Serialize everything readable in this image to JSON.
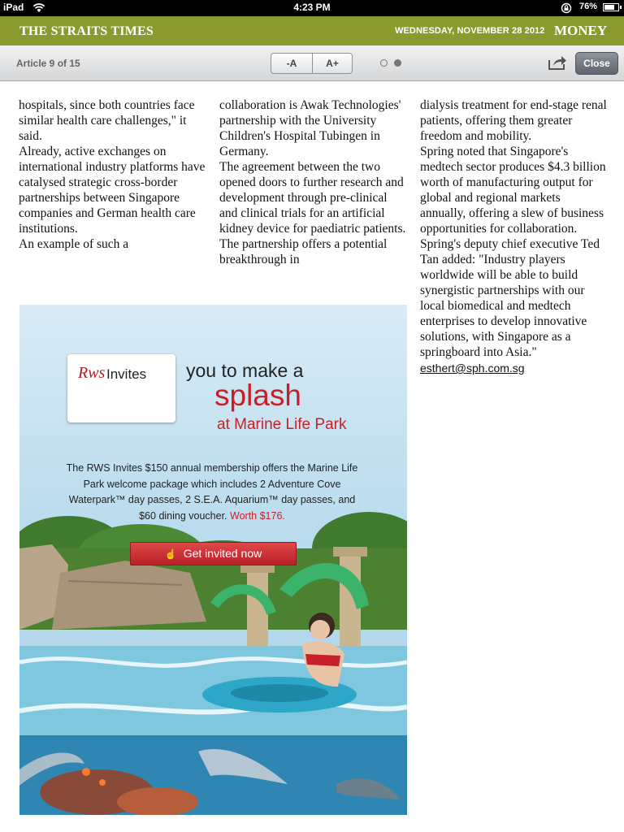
{
  "status_bar": {
    "carrier": "iPad",
    "time": "4:23 PM",
    "battery_percent": "76%",
    "battery_level": 0.76
  },
  "masthead": {
    "logo": "THE STRAITS TIMES",
    "date": "WEDNESDAY, NOVEMBER 28 2012",
    "section": "MONEY",
    "brand_color": "#8a9a2e"
  },
  "toolbar": {
    "article_counter": "Article 9 of 15",
    "font_decrease_label": "-A",
    "font_increase_label": "A+",
    "page_count": 2,
    "current_page": 2,
    "close_label": "Close"
  },
  "article": {
    "col1": "hospitals, since both countries face similar health care challenges,\" it said.\n Already, active exchanges on international industry platforms have catalysed strategic cross-border partnerships between Singapore companies and German health care institutions.\n An example of such a",
    "col2": "collaboration is Awak Technologies' partnership with the University Children's Hospital Tubingen in Germany.\n The agreement between the two opened doors to further research and development through pre-clinical and clinical trials for an artificial kidney device for paediatric patients.\n The partnership offers a potential breakthrough in",
    "col3": "dialysis treatment for end-stage renal patients, offering them greater freedom and mobility.\n Spring noted that Singapore's medtech sector produces $4.3 billion worth of manufacturing output for global and regional markets annually, offering a slew of business opportunities for collaboration.\n Spring's deputy chief executive Ted Tan added: \"Industry players worldwide will be able to build synergistic partnerships with our local biomedical and medtech enterprises to develop innovative solutions, with Singapore as a springboard into Asia.\"",
    "author_email": "esthert@sph.com.sg"
  },
  "ad": {
    "card_brand": "Rws",
    "card_invites": "Invites",
    "headline_1": "you to make a",
    "headline_2": "splash",
    "headline_3": "at Marine Life Park",
    "body": "The RWS Invites $150 annual membership offers the Marine Life Park welcome package which includes 2 Adventure Cove Waterpark™ day passes, 2 S.E.A. Aquarium™ day passes, and $60 dining voucher.",
    "worth": "Worth $176.",
    "cta_label": "Get invited now",
    "accent_color": "#c8202a"
  }
}
